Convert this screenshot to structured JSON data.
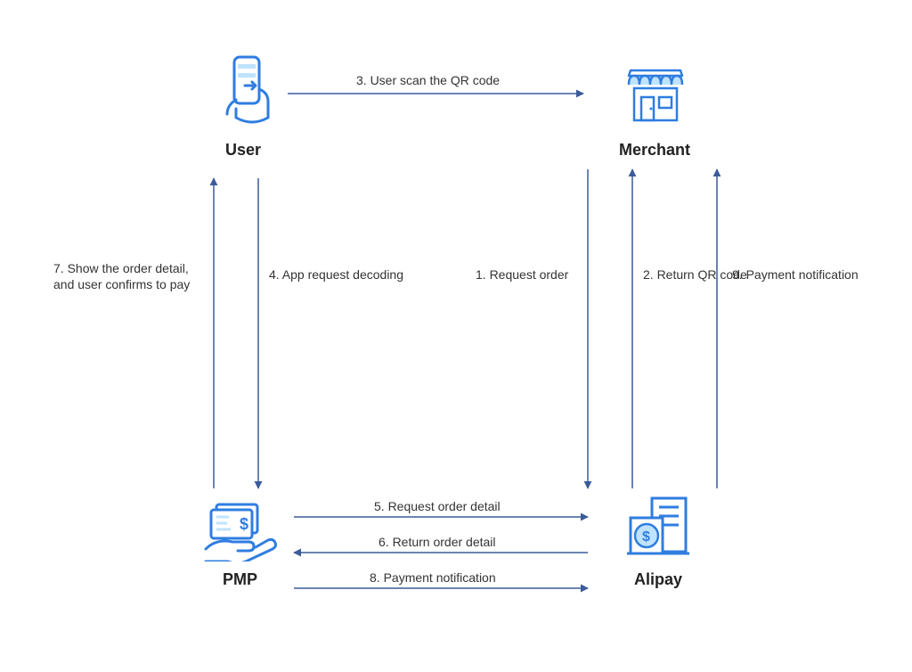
{
  "nodes": {
    "user": {
      "label": "User"
    },
    "merchant": {
      "label": "Merchant"
    },
    "pmp": {
      "label": "PMP"
    },
    "alipay": {
      "label": "Alipay"
    }
  },
  "edges": {
    "e1": {
      "label": "1. Request order"
    },
    "e2": {
      "label": "2. Return QR code"
    },
    "e3": {
      "label": "3. User scan the QR code"
    },
    "e4": {
      "label": "4. App request decoding"
    },
    "e5": {
      "label": "5. Request order detail"
    },
    "e6": {
      "label": "6. Return order detail"
    },
    "e7": {
      "label": "7. Show the order detail,\nand user confirms to pay"
    },
    "e8": {
      "label": "8. Payment notification"
    },
    "e9": {
      "label": "9. Payment notification"
    }
  },
  "colors": {
    "arrow": "#3b5b9a",
    "iconPrimary": "#2f7de1",
    "iconLight": "#bfe3ff"
  }
}
